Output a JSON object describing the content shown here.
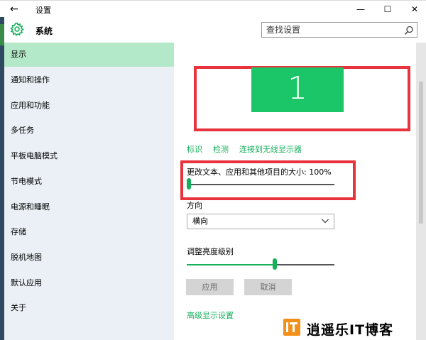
{
  "window": {
    "back_icon": "back-arrow-icon",
    "title": "设置",
    "controls": {
      "minimize": "—",
      "maximize": "☐",
      "close": "✕"
    }
  },
  "header": {
    "icon": "gear-icon",
    "title": "系统",
    "search_placeholder": "查找设置",
    "search_icon": "search-icon"
  },
  "sidebar": {
    "active_color": "#b3e9c8",
    "items": [
      {
        "label": "显示",
        "active": true
      },
      {
        "label": "通知和操作"
      },
      {
        "label": "应用和功能"
      },
      {
        "label": "多任务"
      },
      {
        "label": "平板电脑模式"
      },
      {
        "label": "节电模式"
      },
      {
        "label": "电源和睡眠"
      },
      {
        "label": "存储"
      },
      {
        "label": "脱机地图"
      },
      {
        "label": "默认应用"
      },
      {
        "label": "关于"
      }
    ]
  },
  "display": {
    "monitor_number": "1",
    "monitor_color": "#1bc669",
    "links": {
      "identify": "标识",
      "detect": "检测",
      "connect_wireless": "连接到无线显示器"
    },
    "scale": {
      "label": "更改文本、应用和其他项目的大小: 100%",
      "value": 0
    },
    "orientation": {
      "label": "方向",
      "value": "横向"
    },
    "brightness": {
      "label": "调整亮度级别",
      "value": 0.6
    },
    "buttons": {
      "apply": "应用",
      "cancel": "取消"
    },
    "advanced_link": "高级显示设置",
    "accent": "#16b05c",
    "highlight_color": "#e8333d"
  },
  "watermark": {
    "text": "逍遥乐IT博客",
    "logo_color": "#f39019"
  }
}
